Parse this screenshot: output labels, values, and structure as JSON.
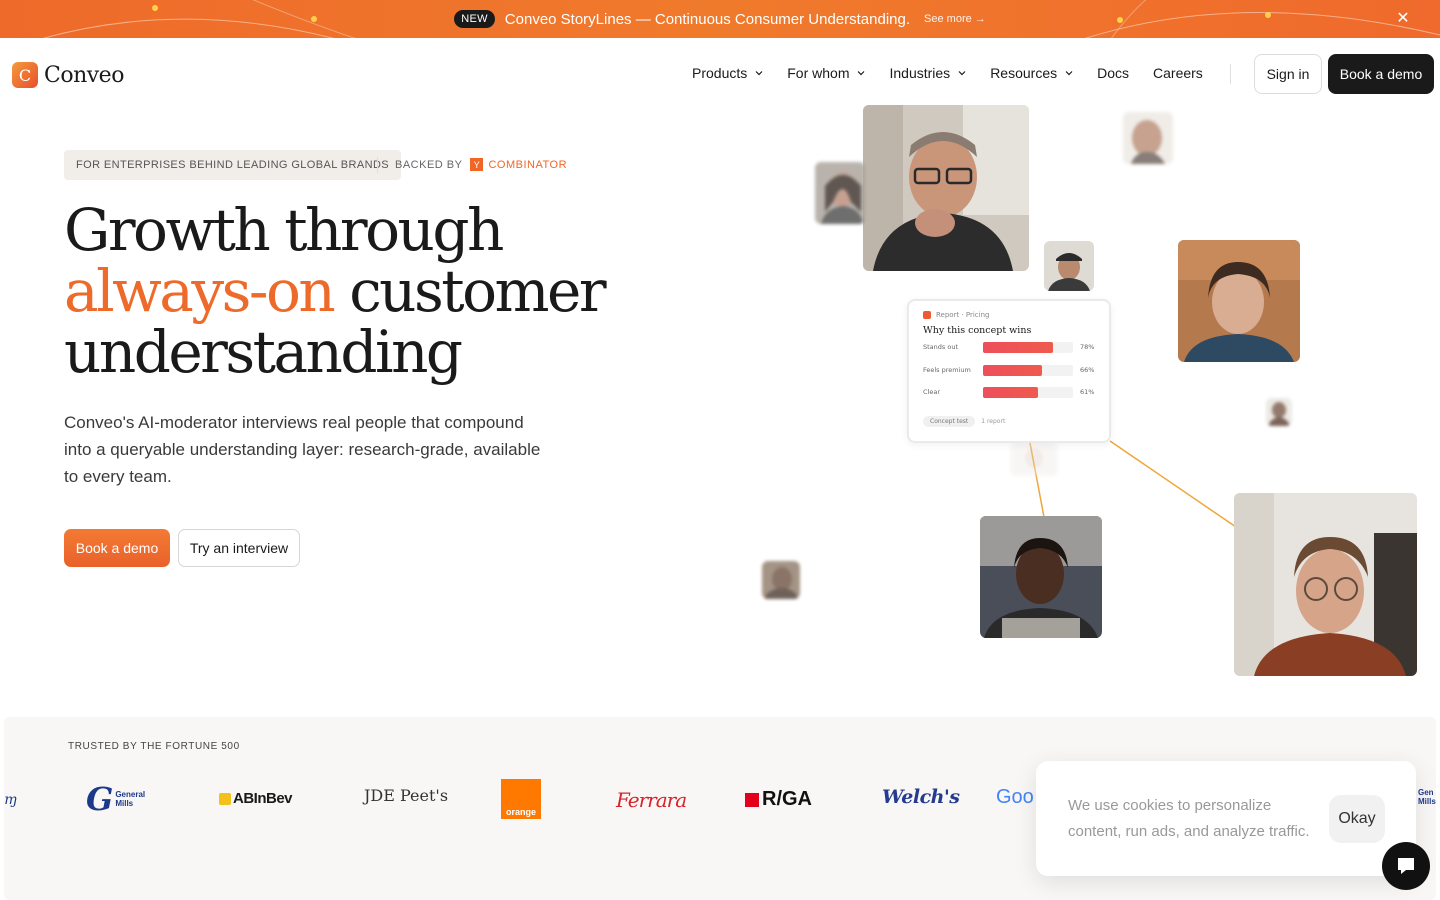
{
  "announcement": {
    "badge": "NEW",
    "text": "Conveo StoryLines — Continuous Consumer Understanding.",
    "link": "See more →",
    "close_icon": "close-icon"
  },
  "nav": {
    "logo_text": "Conveo",
    "logo_mark": "C",
    "items": [
      {
        "label": "Products",
        "has_dropdown": true
      },
      {
        "label": "For whom",
        "has_dropdown": true
      },
      {
        "label": "Industries",
        "has_dropdown": true
      },
      {
        "label": "Resources",
        "has_dropdown": true
      },
      {
        "label": "Docs",
        "has_dropdown": false
      },
      {
        "label": "Careers",
        "has_dropdown": false
      }
    ],
    "signin": "Sign in",
    "demo": "Book a demo"
  },
  "hero": {
    "tag": "FOR ENTERPRISES BEHIND LEADING GLOBAL BRANDS",
    "backed_by": "BACKED BY",
    "yc_mark": "Y",
    "yc_name": "COMBINATOR",
    "headline_1": "Growth through",
    "headline_accent": "always-on",
    "headline_2": " customer",
    "headline_3": "understanding",
    "subcopy": "Conveo's AI-moderator interviews real people that compound into a queryable understanding layer: research-grade, available to every team.",
    "cta_primary": "Book a demo",
    "cta_secondary": "Try an interview"
  },
  "report_card": {
    "breadcrumb": "Report · Pricing",
    "title": "Why this concept wins",
    "rows": [
      {
        "label": "Stands out",
        "value": 78,
        "pct": "78%"
      },
      {
        "label": "Feels premium",
        "value": 66,
        "pct": "66%"
      },
      {
        "label": "Clear",
        "value": 61,
        "pct": "61%"
      }
    ],
    "chip": "Concept test",
    "count": "1 report"
  },
  "trusted": {
    "label": "TRUSTED BY THE FORTUNE 500",
    "brands": [
      "General Mills",
      "ABInBev",
      "JDE Peet's",
      "orange",
      "Ferrara",
      "R/GA",
      "Welch's",
      "Goo"
    ],
    "edge_left": "ɱ",
    "edge_right_1": "Gen",
    "edge_right_2": "Mills"
  },
  "cookie": {
    "text": "We use cookies to personalize content, run ads, and analyze traffic.",
    "button": "Okay"
  },
  "colors": {
    "accent": "#ee6a2a",
    "dark": "#1a1a1a"
  }
}
